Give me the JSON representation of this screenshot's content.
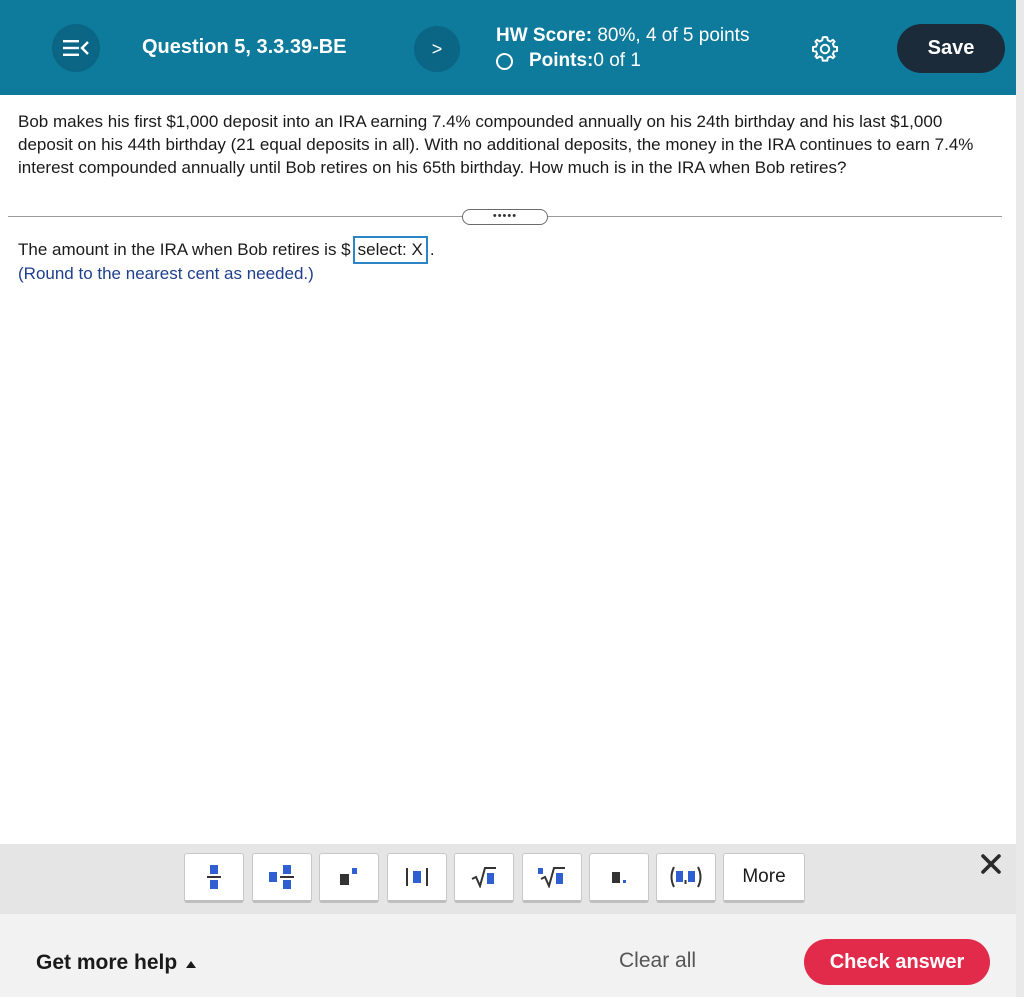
{
  "header": {
    "question_title": "Question 5, 3.3.39-BE",
    "next_label": ">",
    "hw_score_label": "HW Score:",
    "hw_score_value": " 80%, 4 of 5 points",
    "points_label": "Points:",
    "points_value": " 0 of 1",
    "save_label": "Save"
  },
  "question": {
    "text": "Bob makes his first $1,000 deposit into an IRA earning 7.4% compounded annually on his 24th birthday and his last $1,000 deposit on his 44th birthday (21 equal deposits in all). With no additional deposits, the money in the IRA continues to earn 7.4% interest compounded annually until Bob retires on his 65th birthday. How much is in the IRA when Bob retires?",
    "divider_handle": "•••••",
    "answer_prefix": "The amount in the IRA when Bob retires is $",
    "answer_value": "select: X",
    "answer_suffix": ".",
    "round_note": "(Round to the nearest cent as needed.)"
  },
  "toolbar": {
    "tools": [
      "fraction",
      "mixed-number",
      "exponent",
      "absolute-value",
      "square-root",
      "nth-root",
      "decimal",
      "ordered-pair"
    ],
    "more_label": "More"
  },
  "footer": {
    "help_label": "Get more help",
    "clear_label": "Clear all",
    "check_label": "Check answer"
  },
  "colors": {
    "header_bg": "#0e7a9c",
    "save_bg": "#1b2b3a",
    "check_bg": "#e22a4a",
    "answer_border": "#2c86c6",
    "note_color": "#1f3f8e",
    "tool_blue": "#2f5fd0"
  }
}
